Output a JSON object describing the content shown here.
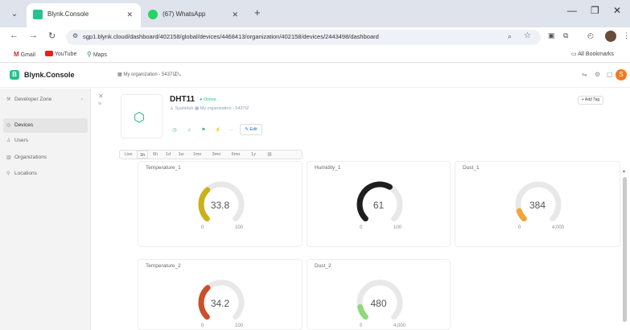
{
  "browser": {
    "tabs": [
      {
        "title": "Blynk.Console",
        "active": true,
        "favicon_color": "#23c48e"
      },
      {
        "title": "(67) WhatsApp",
        "active": false,
        "favicon_color": "#25d366"
      }
    ],
    "url": "sgp1.blynk.cloud/dashboard/402158/global/devices/4468413/organization/402158/devices/2443498/dashboard",
    "bookmarks": {
      "gmail": "Gmail",
      "youtube": "YouTube",
      "maps": "Maps",
      "all": "All Bookmarks"
    }
  },
  "app": {
    "brand": "Blynk.Console",
    "org_selector": "My organization - 5437IZ",
    "avatar_letter": "S"
  },
  "sidebar": {
    "items": [
      {
        "label": "Developer Zone",
        "icon": "wrench-icon"
      },
      {
        "label": "Devices",
        "icon": "devices-icon"
      },
      {
        "label": "Users",
        "icon": "users-icon"
      },
      {
        "label": "Organizations",
        "icon": "organizations-icon"
      },
      {
        "label": "Locations",
        "icon": "location-icon"
      }
    ],
    "selected": "Devices"
  },
  "device": {
    "name": "DHT11",
    "status": "Online",
    "owner": "Syahidah",
    "org": "My organization - 5437IZ",
    "edit_label": "Edit",
    "add_tag_label": "Add Tag"
  },
  "time_ranges": {
    "items": [
      "Live",
      "1h",
      "6h",
      "1d",
      "1w",
      "1mo",
      "3mo",
      "6mo",
      "1y"
    ],
    "active": "1h"
  },
  "widgets": [
    {
      "title": "Temperature_1",
      "value": "33.8",
      "min": "0",
      "max": "100",
      "fraction": 0.338,
      "color": "#c9b21a"
    },
    {
      "title": "Humidity_1",
      "value": "61",
      "min": "0",
      "max": "100",
      "fraction": 0.61,
      "color": "#1e1e1e"
    },
    {
      "title": "Dust_1",
      "value": "384",
      "min": "0",
      "max": "4,000",
      "fraction": 0.096,
      "color": "#f2a33a"
    },
    {
      "title": "Temperature_2",
      "value": "34.2",
      "min": "0",
      "max": "100",
      "fraction": 0.342,
      "color": "#c9502a"
    },
    {
      "title": "Dust_2",
      "value": "480",
      "min": "0",
      "max": "4,000",
      "fraction": 0.12,
      "color": "#8fd97a"
    }
  ]
}
